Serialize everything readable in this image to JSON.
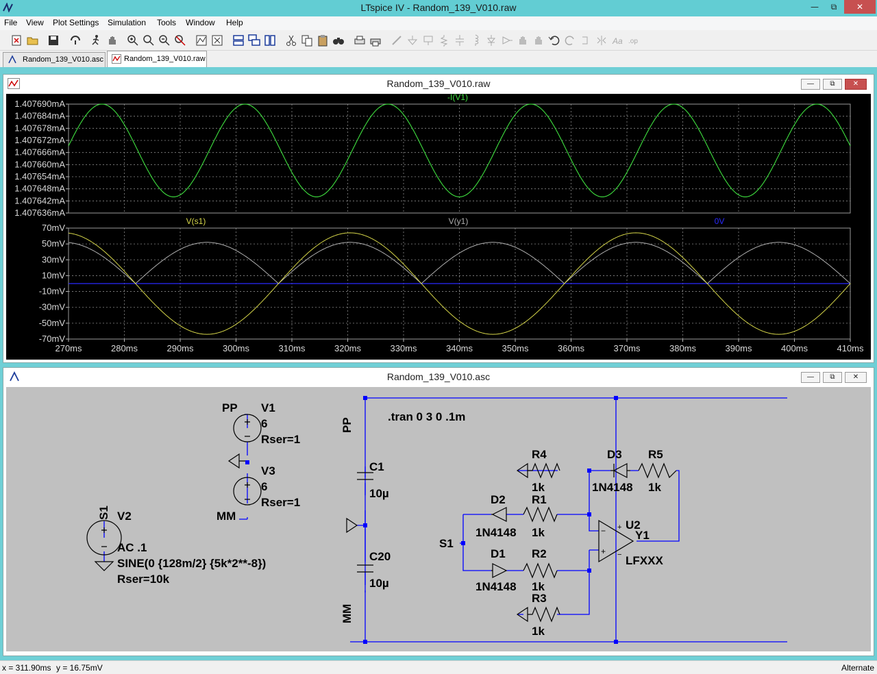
{
  "window": {
    "title": "LTspice IV - Random_139_V010.raw"
  },
  "menu": [
    "File",
    "View",
    "Plot Settings",
    "Simulation",
    "Tools",
    "Window",
    "Help"
  ],
  "tabs": [
    {
      "label": "Random_139_V010.asc",
      "active": false
    },
    {
      "label": "Random_139_V010.raw",
      "active": true
    }
  ],
  "plot_window": {
    "title": "Random_139_V010.raw",
    "pane1": {
      "trace_label": "-I(V1)",
      "trace_color": "#3fe03f",
      "y_ticks": [
        "1.407690mA",
        "1.407684mA",
        "1.407678mA",
        "1.407672mA",
        "1.407666mA",
        "1.407660mA",
        "1.407654mA",
        "1.407648mA",
        "1.407642mA",
        "1.407636mA"
      ]
    },
    "pane2": {
      "trace_labels": [
        {
          "text": "V(s1)",
          "color": "#d8d84a"
        },
        {
          "text": "V(y1)",
          "color": "#b0b0b0"
        },
        {
          "text": "0V",
          "color": "#2a2aff"
        }
      ],
      "y_ticks": [
        "70mV",
        "50mV",
        "30mV",
        "10mV",
        "-10mV",
        "-30mV",
        "-50mV",
        "-70mV"
      ]
    },
    "x_ticks": [
      "270ms",
      "280ms",
      "290ms",
      "300ms",
      "310ms",
      "320ms",
      "330ms",
      "340ms",
      "350ms",
      "360ms",
      "370ms",
      "380ms",
      "390ms",
      "400ms",
      "410ms"
    ]
  },
  "chart_data": [
    {
      "type": "line",
      "x_range_ms": [
        270,
        410
      ],
      "ylim_mA": [
        1.407636,
        1.40769
      ],
      "grid": true,
      "series": [
        {
          "name": "-I(V1)",
          "shape": "sinusoid",
          "period_ms": 25.6,
          "min_mA": 1.407644,
          "max_mA": 1.40769,
          "peaks_at_ms": [
            276,
            301.6,
            327.2,
            352.8,
            378.4,
            404
          ],
          "color": "#3fe03f"
        }
      ]
    },
    {
      "type": "line",
      "x_range_ms": [
        270,
        410
      ],
      "ylim_mV": [
        -70,
        70
      ],
      "grid": true,
      "series": [
        {
          "name": "V(s1)",
          "shape": "sinusoid",
          "amplitude_mV": 64,
          "period_ms": 51.2,
          "peaks_at_ms": [
            320.4,
            371.6
          ],
          "troughs_at_ms": [
            294.8,
            346,
            397.2
          ],
          "color": "#d8d84a"
        },
        {
          "name": "V(y1)",
          "shape": "rectified-sinusoid",
          "max_mV": 52,
          "min_mV": 0,
          "peaks_at_ms": [
            269,
            294.8,
            320.4,
            346,
            371.6,
            397.2
          ],
          "zeros_at_ms": [
            282,
            308,
            333.5,
            359,
            384.5,
            410
          ],
          "color": "#b0b0b0"
        },
        {
          "name": "0V",
          "value_mV": 0,
          "color": "#2a2aff"
        }
      ]
    }
  ],
  "schematic_window": {
    "title": "Random_139_V010.asc",
    "labels": {
      "pp1": "PP",
      "v1": "V1",
      "v1_val": "6",
      "v1_rser": "Rser=1",
      "v3": "V3",
      "v3_val": "6",
      "v3_rser": "Rser=1",
      "mm1": "MM",
      "s1_lbl": "S1",
      "v2": "V2",
      "v2_ac": "AC .1",
      "v2_sine": "SINE(0 {128m/2} {5k*2**-8})",
      "v2_rser": "Rser=10k",
      "pp2": "PP",
      "tran": ".tran 0 3 0 .1m",
      "c1": "C1",
      "c1_val": "10µ",
      "c20": "C20",
      "c20_val": "10µ",
      "mm2": "MM",
      "r4": "R4",
      "r4_val": "1k",
      "d3": "D3",
      "d3_val": "1N4148",
      "r5": "R5",
      "r5_val": "1k",
      "d2": "D2",
      "d2_val": "1N4148",
      "r1": "R1",
      "r1_val": "1k",
      "u2": "U2",
      "y1": "Y1",
      "lfxxx": "LFXXX",
      "s1_in": "S1",
      "d1": "D1",
      "d1_val": "1N4148",
      "r2": "R2",
      "r2_val": "1k",
      "r3": "R3",
      "r3_val": "1k"
    }
  },
  "status": {
    "x": "x = 311.90ms",
    "y": "y = 16.75mV",
    "mode": "Alternate"
  }
}
